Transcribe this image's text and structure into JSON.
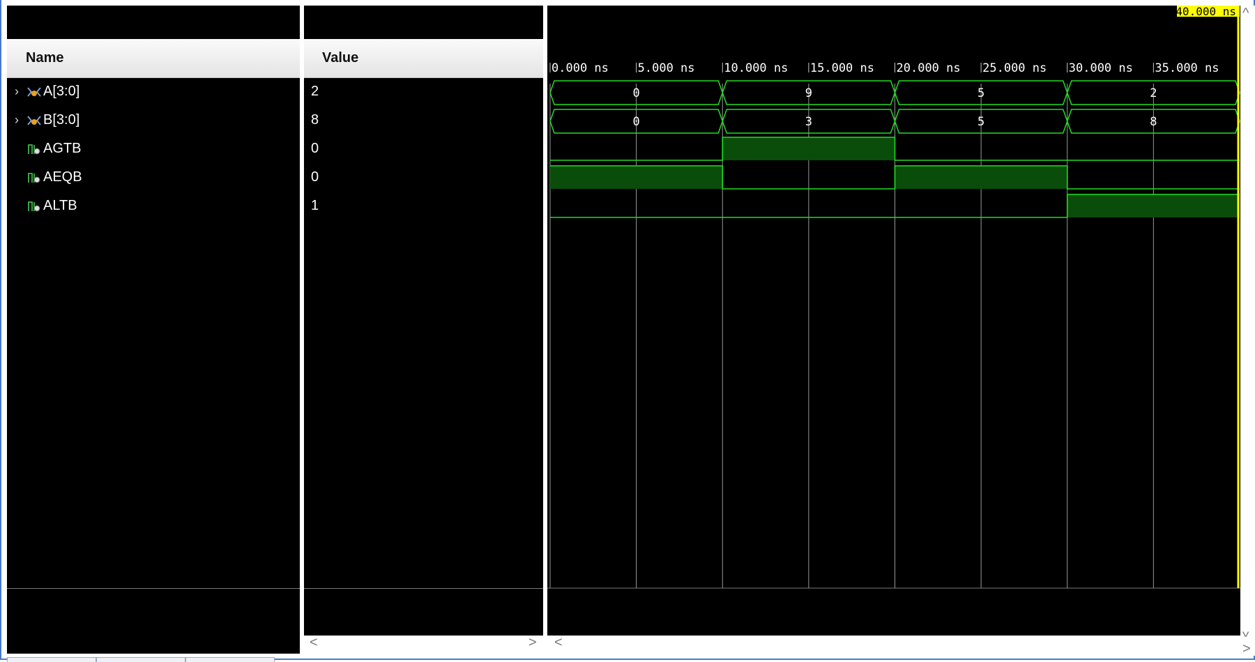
{
  "columns": {
    "name": "Name",
    "value": "Value"
  },
  "signals": [
    {
      "name": "A[3:0]",
      "value": "2",
      "type": "bus",
      "expandable": true
    },
    {
      "name": "B[3:0]",
      "value": "8",
      "type": "bus",
      "expandable": true
    },
    {
      "name": "AGTB",
      "value": "0",
      "type": "bit",
      "expandable": false
    },
    {
      "name": "AEQB",
      "value": "0",
      "type": "bit",
      "expandable": false
    },
    {
      "name": "ALTB",
      "value": "1",
      "type": "bit",
      "expandable": false
    }
  ],
  "cursor_label": "40.000 ns",
  "time_ticks": [
    "0.000 ns",
    "5.000 ns",
    "10.000 ns",
    "15.000 ns",
    "20.000 ns",
    "25.000 ns",
    "30.000 ns",
    "35.000 ns"
  ],
  "waveforms": {
    "time_start_ns": 0,
    "time_end_ns": 40,
    "bus": [
      {
        "signal": "A[3:0]",
        "segments": [
          {
            "start": 0,
            "end": 10,
            "value": "0"
          },
          {
            "start": 10,
            "end": 20,
            "value": "9"
          },
          {
            "start": 20,
            "end": 30,
            "value": "5"
          },
          {
            "start": 30,
            "end": 40,
            "value": "2"
          }
        ]
      },
      {
        "signal": "B[3:0]",
        "segments": [
          {
            "start": 0,
            "end": 10,
            "value": "0"
          },
          {
            "start": 10,
            "end": 20,
            "value": "3"
          },
          {
            "start": 20,
            "end": 30,
            "value": "5"
          },
          {
            "start": 30,
            "end": 40,
            "value": "8"
          }
        ]
      }
    ],
    "bits": [
      {
        "signal": "AGTB",
        "levels": [
          0,
          1,
          0,
          0
        ]
      },
      {
        "signal": "AEQB",
        "levels": [
          1,
          0,
          1,
          0
        ]
      },
      {
        "signal": "ALTB",
        "levels": [
          0,
          0,
          0,
          1
        ]
      }
    ]
  },
  "colors": {
    "wave_line": "#22dd22",
    "wave_fill": "#0a4d0a",
    "grid": "#9a9a9a",
    "cursor": "#ffff00",
    "background": "#000000"
  },
  "icons": {
    "expand": "chevron-right-icon",
    "bus": "bus-signal-icon",
    "bit": "bit-signal-icon",
    "scroll_left": "arrow-left-icon",
    "scroll_right": "arrow-right-icon",
    "scroll_up": "arrow-up-icon",
    "scroll_down": "arrow-down-icon"
  }
}
